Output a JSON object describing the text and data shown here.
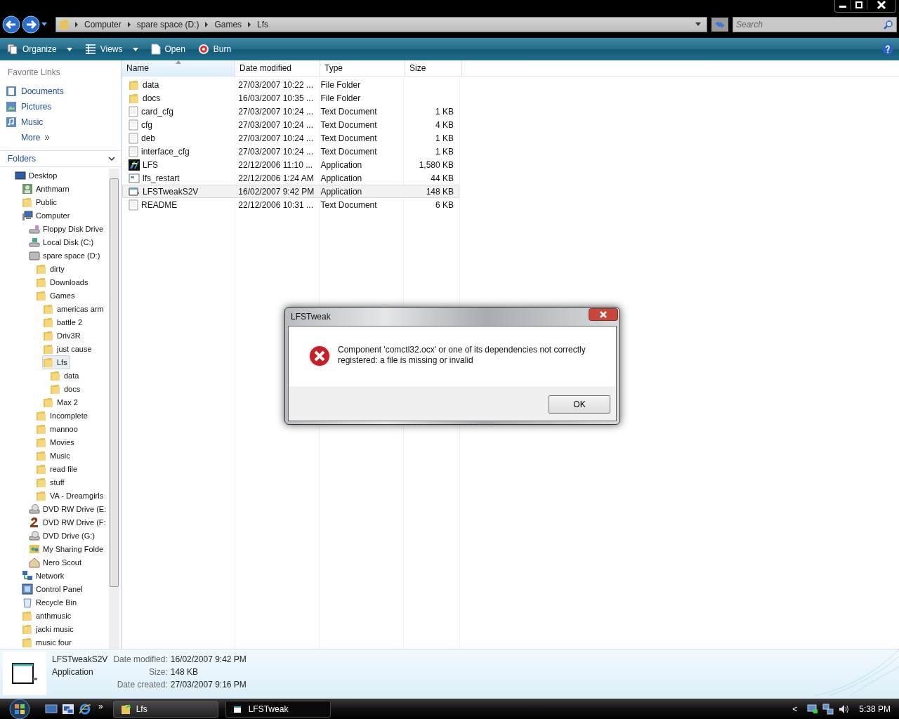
{
  "window": {
    "breadcrumb": [
      "Computer",
      "spare space (D:)",
      "Games",
      "Lfs"
    ],
    "search": {
      "placeholder": "Search"
    }
  },
  "toolbar": [
    {
      "label": "Organize",
      "kind": "organize",
      "dropdown": true
    },
    {
      "label": "Views",
      "kind": "views",
      "dropdown": true
    },
    {
      "label": "Open",
      "kind": "open",
      "dropdown": false
    },
    {
      "label": "Burn",
      "kind": "burn",
      "dropdown": false
    }
  ],
  "favorite_links": {
    "title": "Favorite Links",
    "items": [
      {
        "label": "Documents",
        "kind": "documents"
      },
      {
        "label": "Pictures",
        "kind": "pictures"
      },
      {
        "label": "Music",
        "kind": "music"
      }
    ],
    "more": "More"
  },
  "folders": {
    "title": "Folders",
    "tree": [
      {
        "label": "Desktop",
        "kind": "desktop",
        "selected": false,
        "children": [
          {
            "label": "Anthmarn",
            "kind": "user",
            "selected": false
          },
          {
            "label": "Public",
            "kind": "folder",
            "selected": false
          },
          {
            "label": "Computer",
            "kind": "computer",
            "selected": false,
            "children": [
              {
                "label": "Floppy Disk Drive",
                "kind": "floppy",
                "selected": false
              },
              {
                "label": "Local Disk (C:)",
                "kind": "disk-c",
                "selected": false
              },
              {
                "label": "spare space (D:)",
                "kind": "disk",
                "selected": false,
                "children": [
                  {
                    "label": "dirty",
                    "kind": "folder",
                    "selected": false
                  },
                  {
                    "label": "Downloads",
                    "kind": "folder",
                    "selected": false
                  },
                  {
                    "label": "Games",
                    "kind": "folder",
                    "selected": false,
                    "children": [
                      {
                        "label": "americas arm",
                        "kind": "folder",
                        "selected": false
                      },
                      {
                        "label": "battle 2",
                        "kind": "folder",
                        "selected": false
                      },
                      {
                        "label": "Driv3R",
                        "kind": "folder",
                        "selected": false
                      },
                      {
                        "label": "just cause",
                        "kind": "folder",
                        "selected": false
                      },
                      {
                        "label": "Lfs",
                        "kind": "folder",
                        "selected": true,
                        "children": [
                          {
                            "label": "data",
                            "kind": "folder",
                            "selected": false
                          },
                          {
                            "label": "docs",
                            "kind": "folder",
                            "selected": false
                          }
                        ]
                      },
                      {
                        "label": "Max 2",
                        "kind": "folder",
                        "selected": false
                      }
                    ]
                  },
                  {
                    "label": "Incomplete",
                    "kind": "folder",
                    "selected": false
                  },
                  {
                    "label": "mannoo",
                    "kind": "folder",
                    "selected": false
                  },
                  {
                    "label": "Movies",
                    "kind": "folder",
                    "selected": false
                  },
                  {
                    "label": "Music",
                    "kind": "folder",
                    "selected": false
                  },
                  {
                    "label": "read file",
                    "kind": "folder",
                    "selected": false
                  },
                  {
                    "label": "stuff",
                    "kind": "folder",
                    "selected": false
                  },
                  {
                    "label": "VA - Dreamgirls",
                    "kind": "folder",
                    "selected": false
                  }
                ]
              },
              {
                "label": "DVD RW Drive (E:",
                "kind": "dvd",
                "selected": false
              },
              {
                "label": "DVD RW Drive (F:",
                "kind": "dvd-two",
                "selected": false
              },
              {
                "label": "DVD Drive (G:)",
                "kind": "dvd",
                "selected": false
              },
              {
                "label": "My Sharing Folde",
                "kind": "sharing",
                "selected": false
              },
              {
                "label": "Nero Scout",
                "kind": "nero",
                "selected": false
              }
            ]
          },
          {
            "label": "Network",
            "kind": "network",
            "selected": false
          },
          {
            "label": "Control Panel",
            "kind": "control-panel",
            "selected": false
          },
          {
            "label": "Recycle Bin",
            "kind": "recycle",
            "selected": false
          },
          {
            "label": "anthmusic",
            "kind": "folder",
            "selected": false
          },
          {
            "label": "jacki music",
            "kind": "folder",
            "selected": false
          },
          {
            "label": "music four",
            "kind": "folder",
            "selected": false
          }
        ]
      }
    ]
  },
  "table": {
    "columns": [
      "Name",
      "Date modified",
      "Type",
      "Size"
    ],
    "rows": [
      {
        "name": "data",
        "kind": "folder",
        "date": "27/03/2007 10:22 ...",
        "type": "File Folder",
        "size": "",
        "selected": false
      },
      {
        "name": "docs",
        "kind": "folder",
        "date": "16/03/2007 10:35 ...",
        "type": "File Folder",
        "size": "",
        "selected": false
      },
      {
        "name": "card_cfg",
        "kind": "text",
        "date": "27/03/2007 10:24 ...",
        "type": "Text Document",
        "size": "1 KB",
        "selected": false
      },
      {
        "name": "cfg",
        "kind": "text",
        "date": "27/03/2007 10:24 ...",
        "type": "Text Document",
        "size": "4 KB",
        "selected": false
      },
      {
        "name": "deb",
        "kind": "text",
        "date": "27/03/2007 10:24 ...",
        "type": "Text Document",
        "size": "1 KB",
        "selected": false
      },
      {
        "name": "interface_cfg",
        "kind": "text",
        "date": "27/03/2007 10:24 ...",
        "type": "Text Document",
        "size": "1 KB",
        "selected": false
      },
      {
        "name": "LFS",
        "kind": "app-logo",
        "date": "22/12/2006 11:10 ...",
        "type": "Application",
        "size": "1,580 KB",
        "selected": false
      },
      {
        "name": "lfs_restart",
        "kind": "app-window",
        "date": "22/12/2006 1:24 AM",
        "type": "Application",
        "size": "44 KB",
        "selected": false
      },
      {
        "name": "LFSTweakS2V",
        "kind": "app-generic",
        "date": "16/02/2007 9:42 PM",
        "type": "Application",
        "size": "148 KB",
        "selected": true
      },
      {
        "name": "README",
        "kind": "text",
        "date": "22/12/2006 10:31 ...",
        "type": "Text Document",
        "size": "6 KB",
        "selected": false
      }
    ]
  },
  "dialog": {
    "title": "LFSTweak",
    "message": "Component 'comctl32.ocx' or one of its dependencies not correctly registered: a file is missing or invalid",
    "button": "OK"
  },
  "details": {
    "name": "LFSTweakS2V",
    "type": "Application",
    "fields": [
      {
        "label": "Date modified:",
        "value": "16/02/2007 9:42 PM"
      },
      {
        "label": "Size:",
        "value": "148 KB"
      },
      {
        "label": "Date created:",
        "value": "27/03/2007 9:16 PM"
      }
    ]
  },
  "taskbar": {
    "chevron": "»",
    "tasks": [
      {
        "label": "Lfs",
        "kind": "folder",
        "selected": false
      },
      {
        "label": "LFSTweak",
        "kind": "app",
        "selected": true
      }
    ],
    "tray_arrow": "<",
    "clock": "5:38 PM"
  }
}
